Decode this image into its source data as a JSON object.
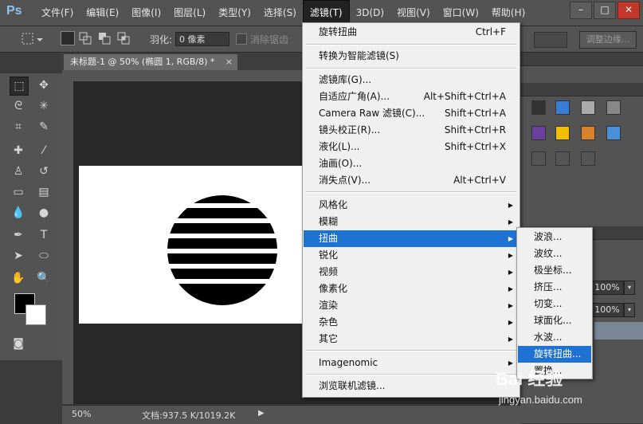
{
  "app": {
    "logo": "Ps"
  },
  "menu": {
    "items": [
      "文件(F)",
      "编辑(E)",
      "图像(I)",
      "图层(L)",
      "类型(Y)",
      "选择(S)",
      "滤镜(T)",
      "3D(D)",
      "视图(V)",
      "窗口(W)",
      "帮助(H)"
    ],
    "active_index": 6
  },
  "window_controls": {
    "minimize": "–",
    "maximize": "□",
    "close": "✕"
  },
  "options": {
    "feather_label": "羽化:",
    "feather_value": "0 像素",
    "antialias_label": "消除锯齿",
    "refine_edge": "调整边缘..."
  },
  "document": {
    "tab_title": "未标题-1 @ 50% (椭圆 1, RGB/8) *",
    "close": "×"
  },
  "status": {
    "zoom": "50%",
    "doc_size": "文档:937.5 K/1019.2K",
    "arrow": "▶"
  },
  "panels": {
    "opacity": "100%",
    "fill": "100%",
    "arrow": "▾"
  },
  "filter_menu": {
    "items": [
      {
        "label": "旋转扭曲",
        "shortcut": "Ctrl+F"
      },
      {
        "label": "转换为智能滤镜(S)",
        "shortcut": ""
      },
      {
        "label": "滤镜库(G)...",
        "shortcut": ""
      },
      {
        "label": "自适应广角(A)...",
        "shortcut": "Alt+Shift+Ctrl+A"
      },
      {
        "label": "Camera Raw 滤镜(C)...",
        "shortcut": "Shift+Ctrl+A"
      },
      {
        "label": "镜头校正(R)...",
        "shortcut": "Shift+Ctrl+R"
      },
      {
        "label": "液化(L)...",
        "shortcut": "Shift+Ctrl+X"
      },
      {
        "label": "油画(O)...",
        "shortcut": ""
      },
      {
        "label": "消失点(V)...",
        "shortcut": "Alt+Ctrl+V"
      },
      {
        "label": "风格化",
        "shortcut": ""
      },
      {
        "label": "模糊",
        "shortcut": ""
      },
      {
        "label": "扭曲",
        "shortcut": ""
      },
      {
        "label": "锐化",
        "shortcut": ""
      },
      {
        "label": "视频",
        "shortcut": ""
      },
      {
        "label": "像素化",
        "shortcut": ""
      },
      {
        "label": "渲染",
        "shortcut": ""
      },
      {
        "label": "杂色",
        "shortcut": ""
      },
      {
        "label": "其它",
        "shortcut": ""
      },
      {
        "label": "Imagenomic",
        "shortcut": ""
      },
      {
        "label": "浏览联机滤镜...",
        "shortcut": ""
      }
    ],
    "submenu_arrow": "▶"
  },
  "distort_submenu": {
    "items": [
      "波浪...",
      "波纹...",
      "极坐标...",
      "挤压...",
      "切变...",
      "球面化...",
      "水波...",
      "旋转扭曲...",
      "置换..."
    ],
    "highlighted_index": 7
  },
  "watermark": {
    "logo": "Bai 经验",
    "site": "jingyan.baidu.com"
  }
}
